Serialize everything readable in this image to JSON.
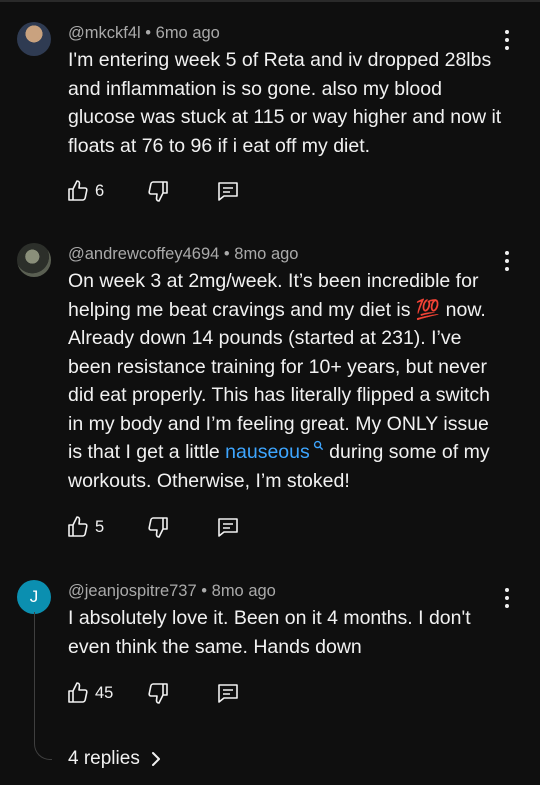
{
  "comments": [
    {
      "author": "@mkckf4l",
      "age": "6mo ago",
      "text": "I'm entering week 5 of Reta and iv dropped 28lbs and inflammation is so gone. also my blood glucose was stuck at 115 or way higher and now it floats at 76 to 96 if i eat off my diet.",
      "likes": "6"
    },
    {
      "author": "@andrewcoffey4694",
      "age": "8mo ago",
      "text_before_link": "On week 3 at 2mg/week.  It’s been incredible for helping me beat cravings and my diet is 💯 now.  Already down 14 pounds (started at 231).  I’ve been resistance training for 10+ years, but never did eat properly.  This has literally flipped a switch in my body and I’m feeling great.  My ONLY issue is that I get a little ",
      "link_text": "nauseous",
      "text_after_link": " during some of my workouts.  Otherwise, I’m stoked!",
      "likes": "5"
    },
    {
      "author": "@jeanjospitre737",
      "age": "8mo ago",
      "avatar_letter": "J",
      "text": "I absolutely love it. Been on it 4 months. I don't even think the same. Hands down",
      "likes": "45"
    }
  ],
  "meta_separator": "•",
  "replies_label": "4 replies",
  "icons": {
    "like": "thumbs-up-icon",
    "dislike": "thumbs-down-icon",
    "reply": "comment-icon",
    "more": "kebab-menu-icon",
    "search_hint": "search-icon",
    "expand": "chevron-right-icon"
  },
  "colors": {
    "background": "#0f0f0f",
    "text": "#f1f1f1",
    "meta": "#aaaaaa",
    "link": "#3ea6ff",
    "avatar_j": "#0b8fb0"
  }
}
